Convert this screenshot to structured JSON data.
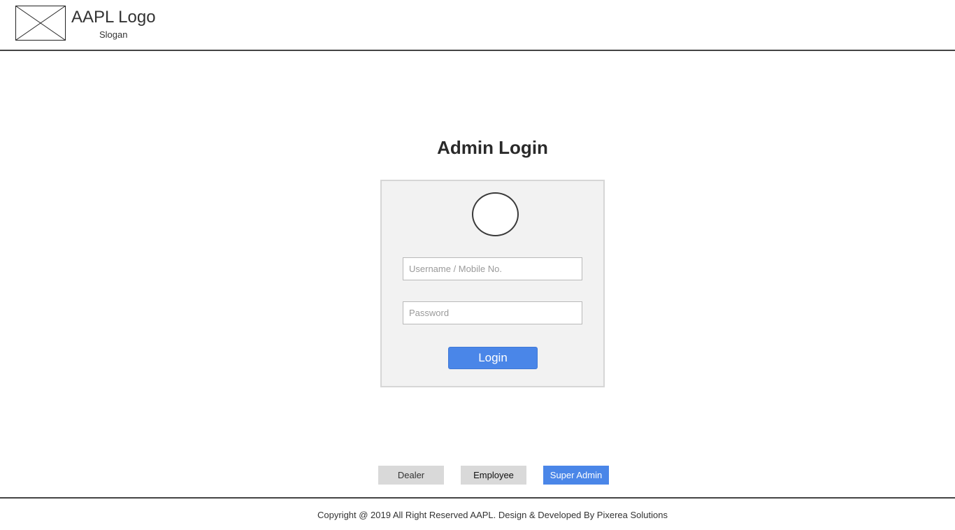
{
  "header": {
    "logo_icon": "image-placeholder-icon",
    "logo_title": "AAPL Logo",
    "slogan": "Slogan"
  },
  "main": {
    "title": "Admin Login",
    "avatar_icon": "avatar-placeholder-icon",
    "username_placeholder": "Username / Mobile No.",
    "password_placeholder": "Password",
    "login_label": "Login"
  },
  "roles": {
    "dealer": "Dealer",
    "employee": "Employee",
    "super_admin": "Super Admin"
  },
  "footer": {
    "copyright": "Copyright @ 2019 All Right Reserved AAPL. Design & Developed By Pixerea Solutions"
  },
  "colors": {
    "accent": "#4a86e8",
    "card_bg": "#f2f2f2",
    "role_inactive": "#d9d9d9"
  }
}
